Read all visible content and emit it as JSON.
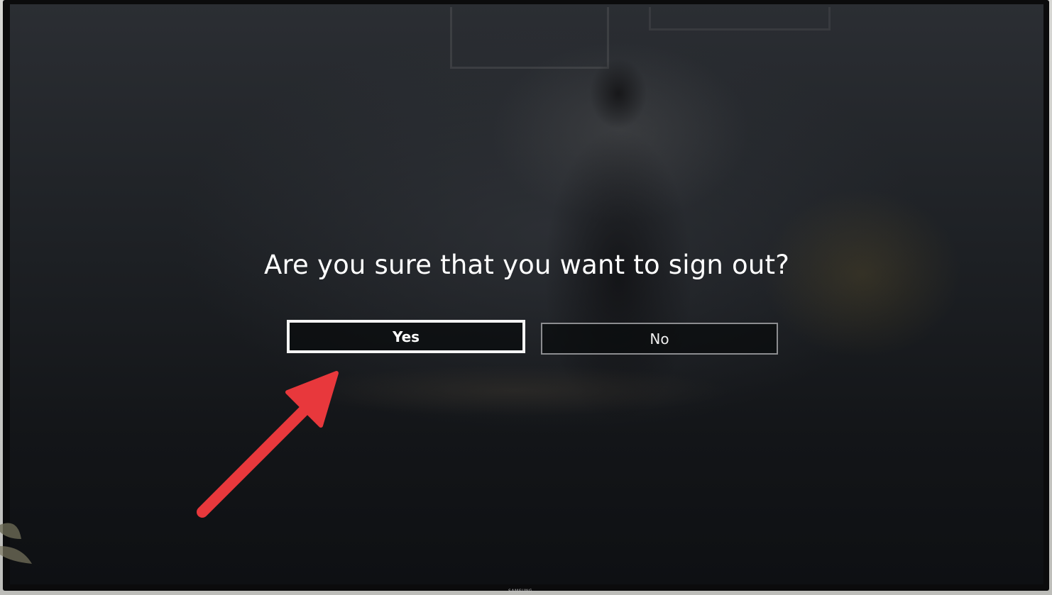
{
  "dialog": {
    "title": "Are you sure that you want to sign out?",
    "buttons": {
      "yes_label": "Yes",
      "no_label": "No"
    },
    "focused_button": "Yes"
  },
  "tv": {
    "brand": "SAMSUNG"
  },
  "annotation": {
    "arrow_color": "#e8383c",
    "points_to": "Yes"
  }
}
